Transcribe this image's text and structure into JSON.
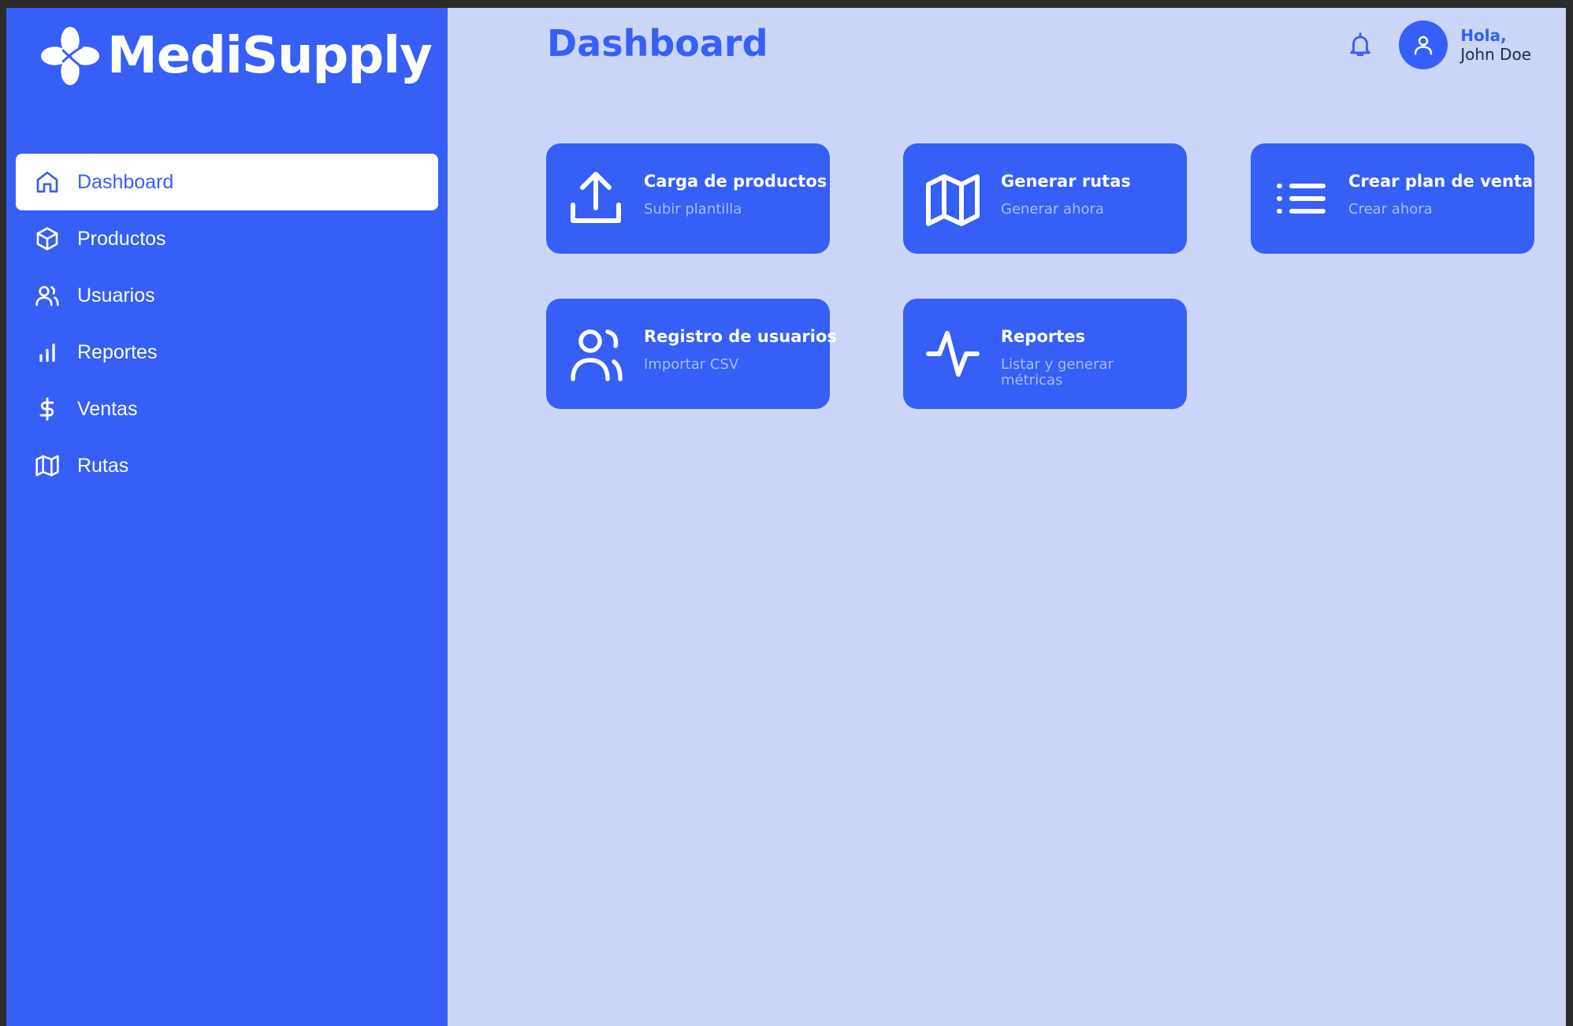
{
  "app": {
    "name": "MediSupply"
  },
  "sidebar": {
    "items": [
      {
        "label": "Dashboard",
        "icon": "home-icon",
        "active": true
      },
      {
        "label": "Productos",
        "icon": "box-icon"
      },
      {
        "label": "Usuarios",
        "icon": "users-icon"
      },
      {
        "label": "Reportes",
        "icon": "bar-chart-icon"
      },
      {
        "label": "Ventas",
        "icon": "dollar-icon"
      },
      {
        "label": "Rutas",
        "icon": "map-icon"
      }
    ]
  },
  "header": {
    "title": "Dashboard",
    "greeting": "Hola,",
    "user_name": "John Doe",
    "notification_icon": "bell-icon",
    "avatar_icon": "user-icon"
  },
  "cards": [
    {
      "title": "Carga de productos",
      "subtitle": "Subir plantilla",
      "icon": "upload-icon"
    },
    {
      "title": "Generar rutas",
      "subtitle": "Generar ahora",
      "icon": "map-icon"
    },
    {
      "title": "Crear plan de venta",
      "subtitle": "Crear ahora",
      "icon": "list-icon"
    },
    {
      "title": "Registro de usuarios",
      "subtitle": "Importar CSV",
      "icon": "users-icon"
    },
    {
      "title": "Reportes",
      "subtitle": "Listar y generar métricas",
      "icon": "activity-icon"
    }
  ],
  "colors": {
    "primary": "#355ff7",
    "background": "#cad5f8",
    "card_subtitle": "#a9bcfc"
  }
}
